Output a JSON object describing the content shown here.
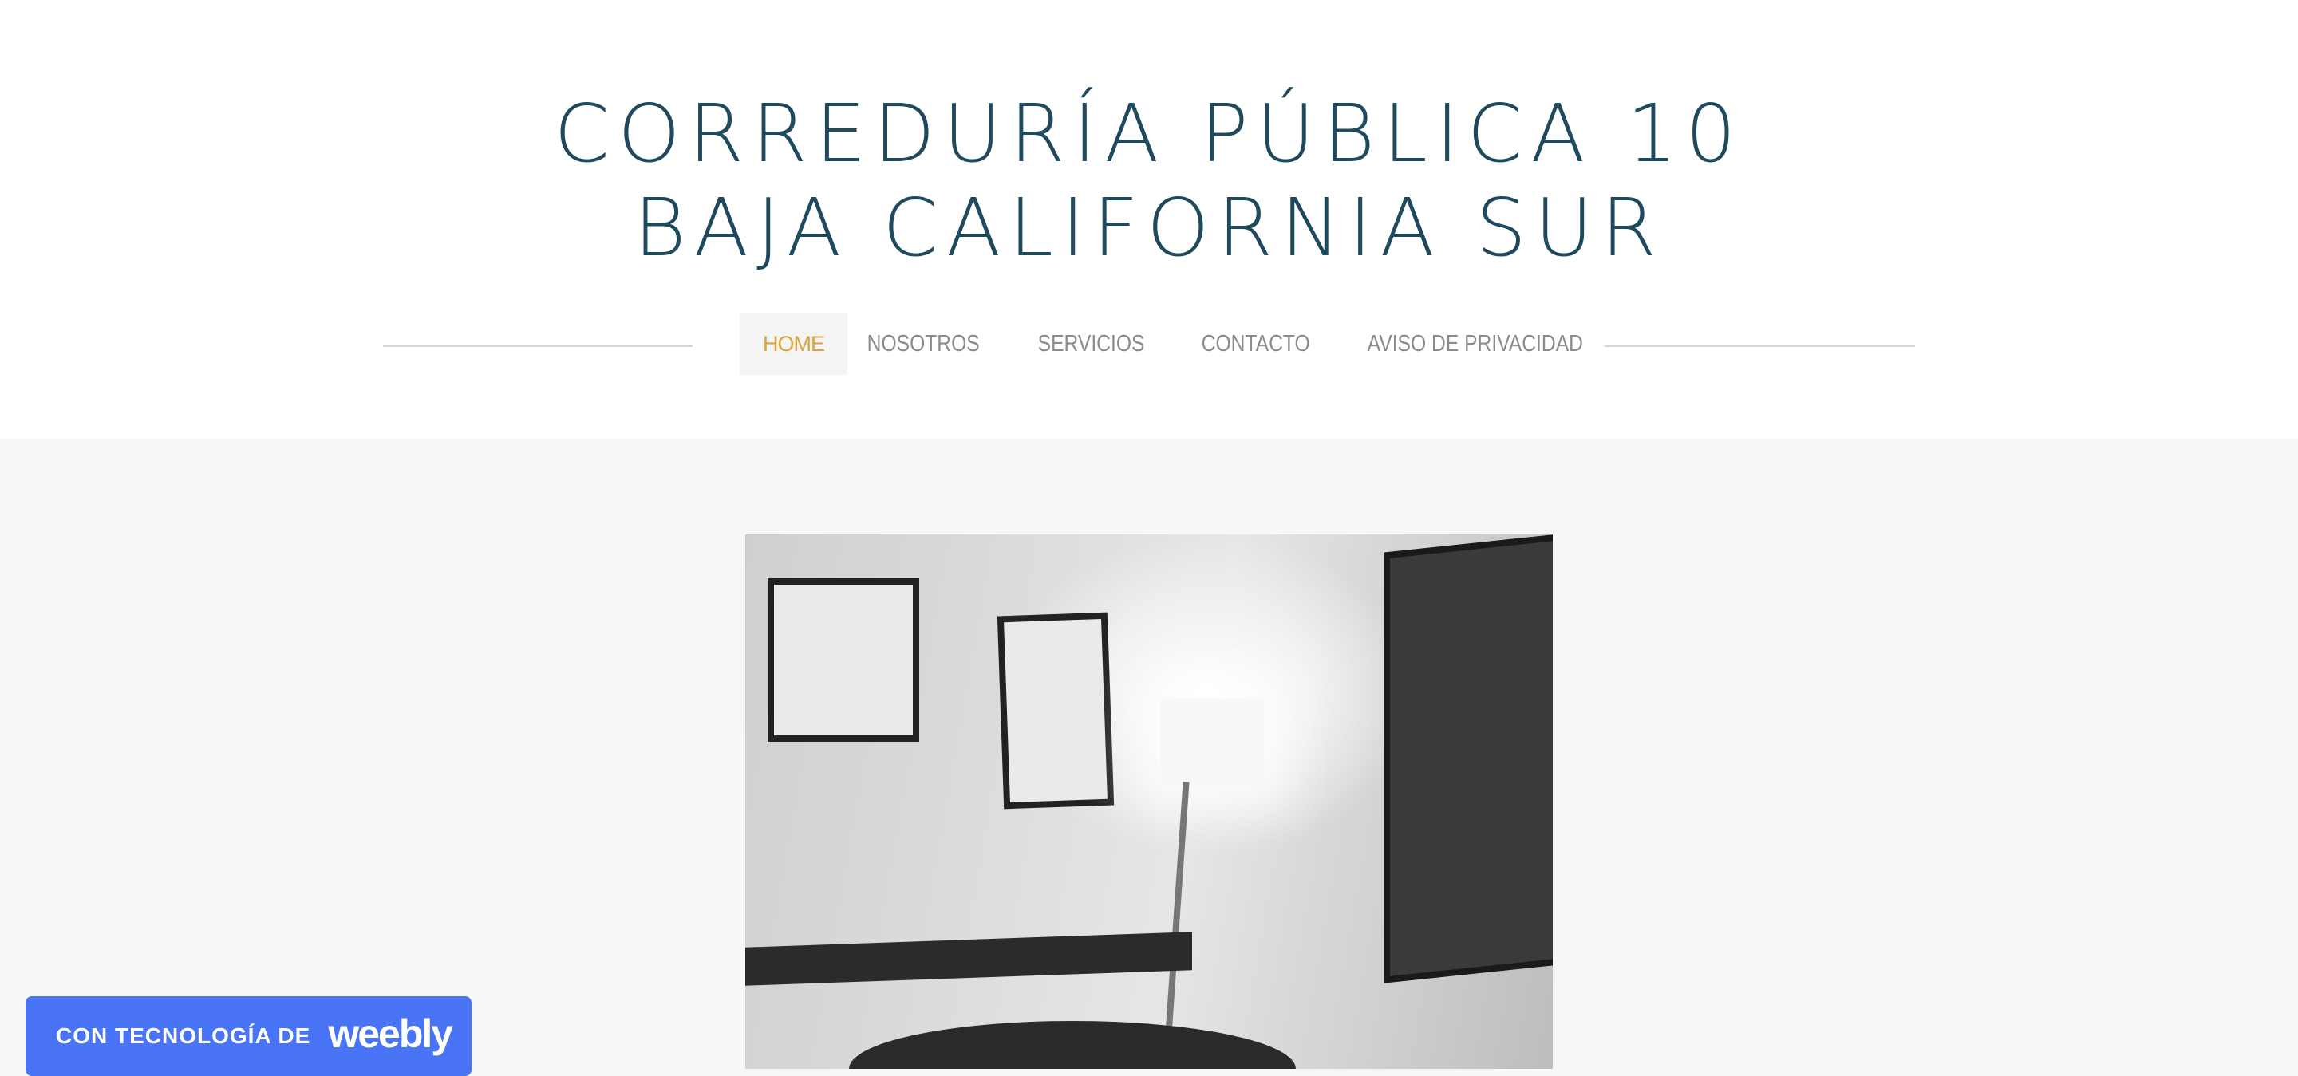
{
  "site": {
    "title_line1": "CORREDURÍA PÚBLICA 10",
    "title_line2": "BAJA CALIFORNIA SUR"
  },
  "nav": {
    "items": [
      {
        "label": "HOME",
        "active": true
      },
      {
        "label": "NOSOTROS"
      },
      {
        "label": "SERVICIOS"
      },
      {
        "label": "CONTACTO"
      },
      {
        "label": "AVISO DE PRIVACIDAD"
      }
    ]
  },
  "badge": {
    "text": "CON TECNOLOGÍA DE",
    "logo": "weebly"
  },
  "colors": {
    "title": "#1f4a5e",
    "nav_active": "#d8a43c",
    "nav": "#8b8b8b",
    "badge": "#4874f5"
  }
}
